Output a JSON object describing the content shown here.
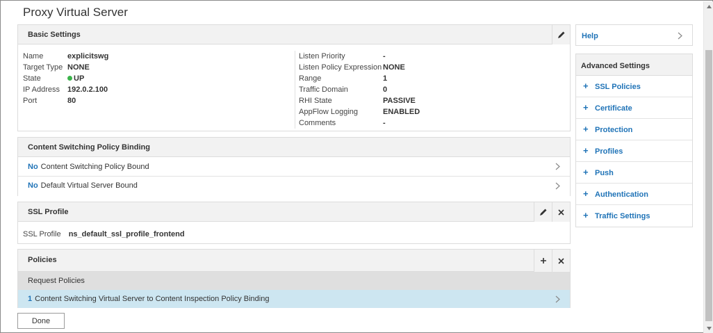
{
  "page": {
    "title": "Proxy Virtual Server"
  },
  "basic_settings": {
    "title": "Basic Settings",
    "left": [
      {
        "label": "Name",
        "value": "explicitswg"
      },
      {
        "label": "Target Type",
        "value": "NONE"
      },
      {
        "label": "State",
        "value": "UP"
      },
      {
        "label": "IP Address",
        "value": "192.0.2.100"
      },
      {
        "label": "Port",
        "value": "80"
      }
    ],
    "right": [
      {
        "label": "Listen Priority",
        "value": "-"
      },
      {
        "label": "Listen Policy Expression",
        "value": "NONE"
      },
      {
        "label": "Range",
        "value": "1"
      },
      {
        "label": "Traffic Domain",
        "value": "0"
      },
      {
        "label": "RHI State",
        "value": "PASSIVE"
      },
      {
        "label": "AppFlow Logging",
        "value": "ENABLED"
      },
      {
        "label": "Comments",
        "value": "-"
      }
    ],
    "status_color": "#3cb44b"
  },
  "cs_binding": {
    "title": "Content Switching Policy Binding",
    "rows": [
      {
        "count": "No",
        "text": "Content Switching Policy Bound"
      },
      {
        "count": "No",
        "text": "Default Virtual Server Bound"
      }
    ]
  },
  "ssl_profile": {
    "title": "SSL Profile",
    "label": "SSL Profile",
    "value": "ns_default_ssl_profile_frontend"
  },
  "policies": {
    "title": "Policies",
    "sub_header": "Request Policies",
    "row": {
      "count": "1",
      "text": "Content Switching Virtual Server to Content Inspection Policy Binding"
    }
  },
  "done_label": "Done",
  "help": {
    "label": "Help"
  },
  "advanced": {
    "title": "Advanced Settings",
    "items": [
      {
        "label": "SSL Policies"
      },
      {
        "label": "Certificate"
      },
      {
        "label": "Protection"
      },
      {
        "label": "Profiles"
      },
      {
        "label": "Push"
      },
      {
        "label": "Authentication"
      },
      {
        "label": "Traffic Settings"
      }
    ]
  },
  "colors": {
    "link": "#1f73b7",
    "panel_header": "#f2f2f2",
    "selected_row": "#cde6f1",
    "sub_header": "#dfdfdf"
  },
  "icons": [
    "pencil-icon",
    "close-icon",
    "plus-icon",
    "chevron-right-icon",
    "status-dot-icon"
  ]
}
